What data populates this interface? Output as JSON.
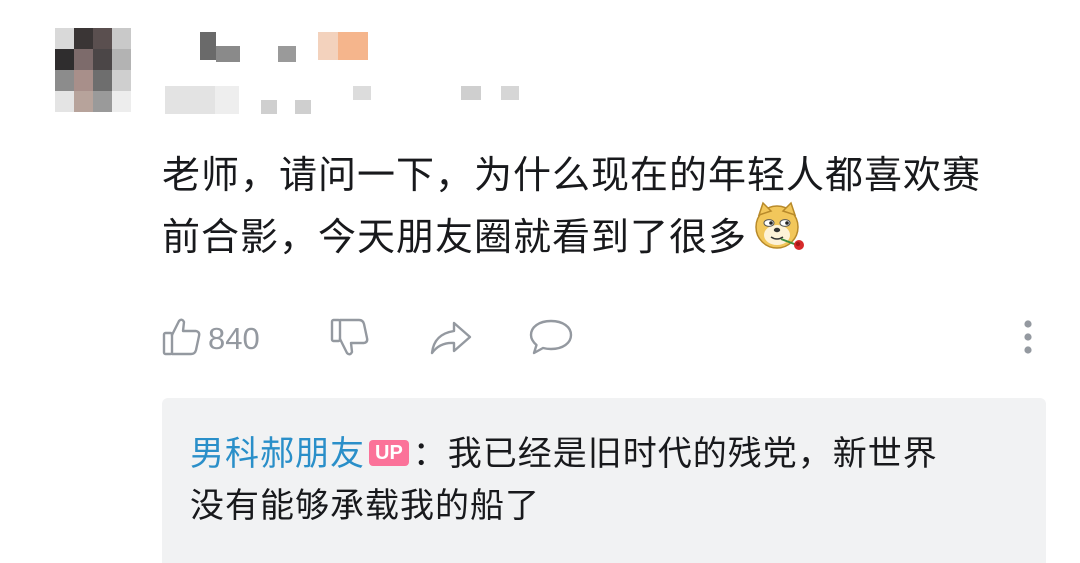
{
  "comment": {
    "text_line1": "老师，请问一下，为什么现在的年轻人都喜欢赛",
    "text_line2": "前合影，今天朋友圈就看到了很多",
    "emoji": "doge-rose-emoji",
    "like_count": "840"
  },
  "actions": {
    "like_icon": "thumbs-up-icon",
    "dislike_icon": "thumbs-down-icon",
    "share_icon": "share-icon",
    "reply_icon": "comment-bubble-icon",
    "more_icon": "more-vertical-icon"
  },
  "reply": {
    "author": "男科郝朋友",
    "badge": "UP",
    "separator": "：",
    "text_line1": "我已经是旧时代的残党，新世界",
    "text_line2": "没有能够承载我的船了"
  },
  "colors": {
    "author_link": "#2a8fc9",
    "up_badge": "#fb7299",
    "reply_bg": "#f1f2f3",
    "icon_gray": "#9499a0"
  }
}
